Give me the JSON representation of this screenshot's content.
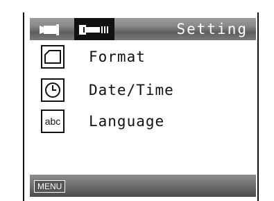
{
  "header": {
    "title": "Setting",
    "tabs": [
      {
        "icon": "video-camera-icon",
        "active": false
      },
      {
        "icon": "wrench-icon",
        "active": true
      }
    ]
  },
  "menu": {
    "items": [
      {
        "icon": "sd-card-icon",
        "label": "Format"
      },
      {
        "icon": "clock-icon",
        "label": "Date/Time"
      },
      {
        "icon": "language-icon",
        "icon_text": "abc",
        "label": "Language"
      }
    ]
  },
  "footer": {
    "menu_button": "MENU"
  },
  "colors": {
    "bar_gray": "#7a7a7a",
    "active_tab": "#111111",
    "text": "#111111"
  }
}
